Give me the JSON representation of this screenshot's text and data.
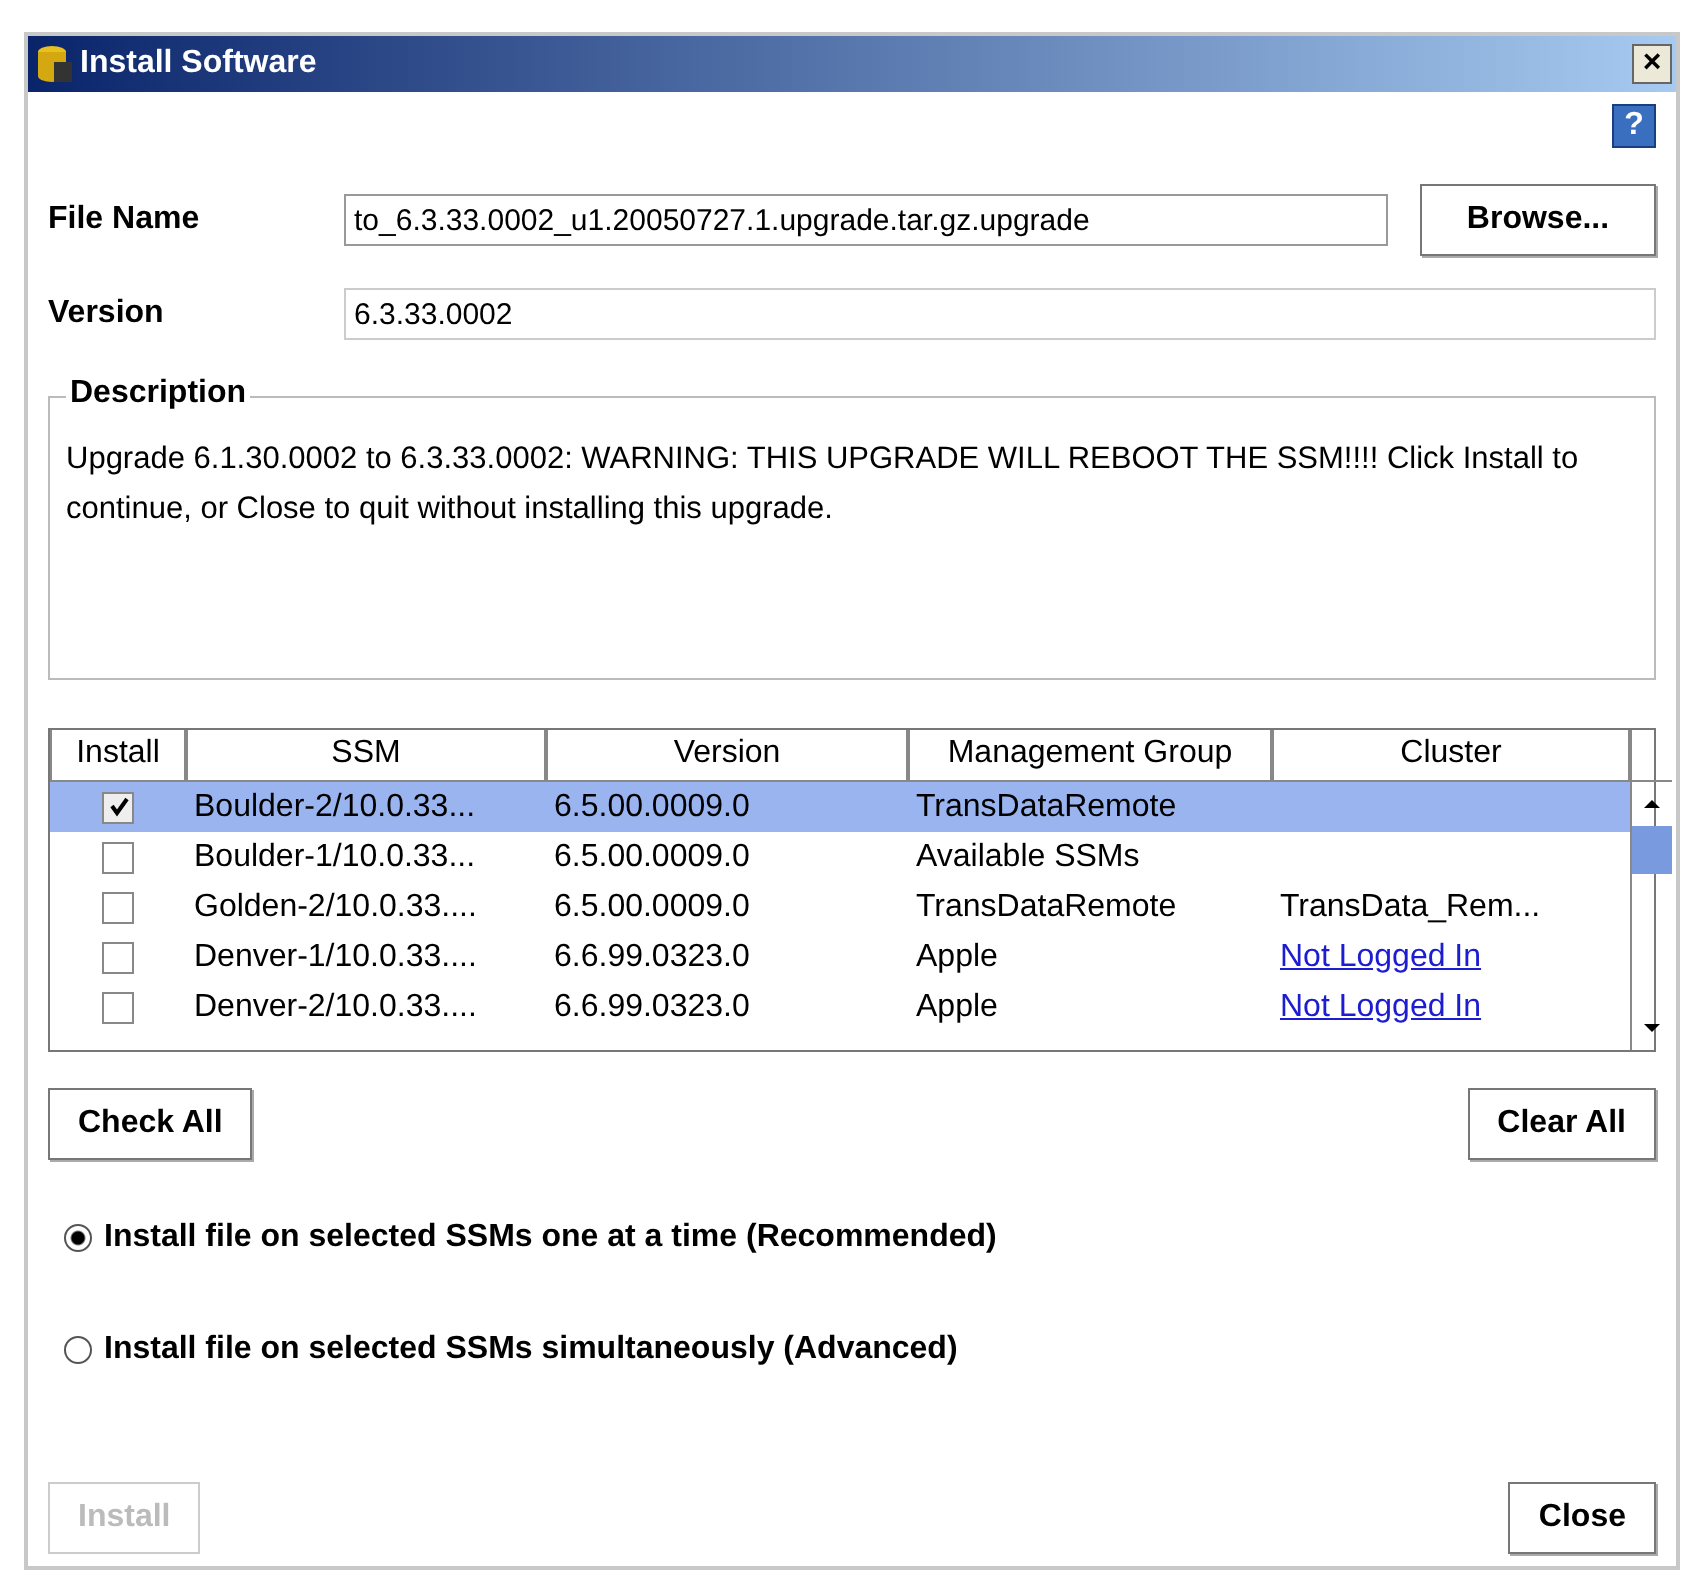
{
  "window": {
    "title": "Install Software",
    "close": "×"
  },
  "help": "?",
  "file_name": {
    "label": "File Name",
    "value": "to_6.3.33.0002_u1.20050727.1.upgrade.tar.gz.upgrade",
    "button": "Browse..."
  },
  "version": {
    "label": "Version",
    "value": "6.3.33.0002"
  },
  "description": {
    "label": "Description",
    "text": "Upgrade 6.1.30.0002 to 6.3.33.0002: WARNING:  THIS UPGRADE WILL REBOOT THE SSM!!!!  Click Install to continue, or Close to quit without installing this upgrade."
  },
  "table": {
    "columns": [
      "Install",
      "SSM",
      "Version",
      "Management Group",
      "Cluster"
    ],
    "rows": [
      {
        "checked": true,
        "selected": true,
        "ssm": "Boulder-2/10.0.33...",
        "version": "6.5.00.0009.0",
        "group": "TransDataRemote"
      },
      {
        "checked": false,
        "selected": false,
        "ssm": "Boulder-1/10.0.33...",
        "version": "6.5.00.0009.0",
        "group": "Available SSMs"
      },
      {
        "checked": false,
        "selected": false,
        "ssm": "Golden-2/10.0.33....",
        "version": "6.5.00.0009.0",
        "group": "TransDataRemote",
        "cluster": {
          "text": "TransData_Rem...",
          "kind": "text"
        }
      },
      {
        "checked": false,
        "selected": false,
        "ssm": "Denver-1/10.0.33....",
        "version": "6.6.99.0323.0",
        "group": "Apple",
        "cluster": {
          "text": "Not Logged In",
          "kind": "link"
        }
      },
      {
        "checked": false,
        "selected": false,
        "ssm": "Denver-2/10.0.33....",
        "version": "6.6.99.0323.0",
        "group": "Apple",
        "cluster": {
          "text": "Not Logged In",
          "kind": "link"
        }
      }
    ]
  },
  "check_all": "Check All",
  "clear_all": "Clear All",
  "options": [
    {
      "label": "Install file on selected SSMs one at a time (Recommended)",
      "selected": true
    },
    {
      "label": "Install file on selected SSMs simultaneously (Advanced)",
      "selected": false
    }
  ],
  "install": {
    "label": "Install",
    "disabled": true
  },
  "close": {
    "label": "Close",
    "disabled": false
  }
}
